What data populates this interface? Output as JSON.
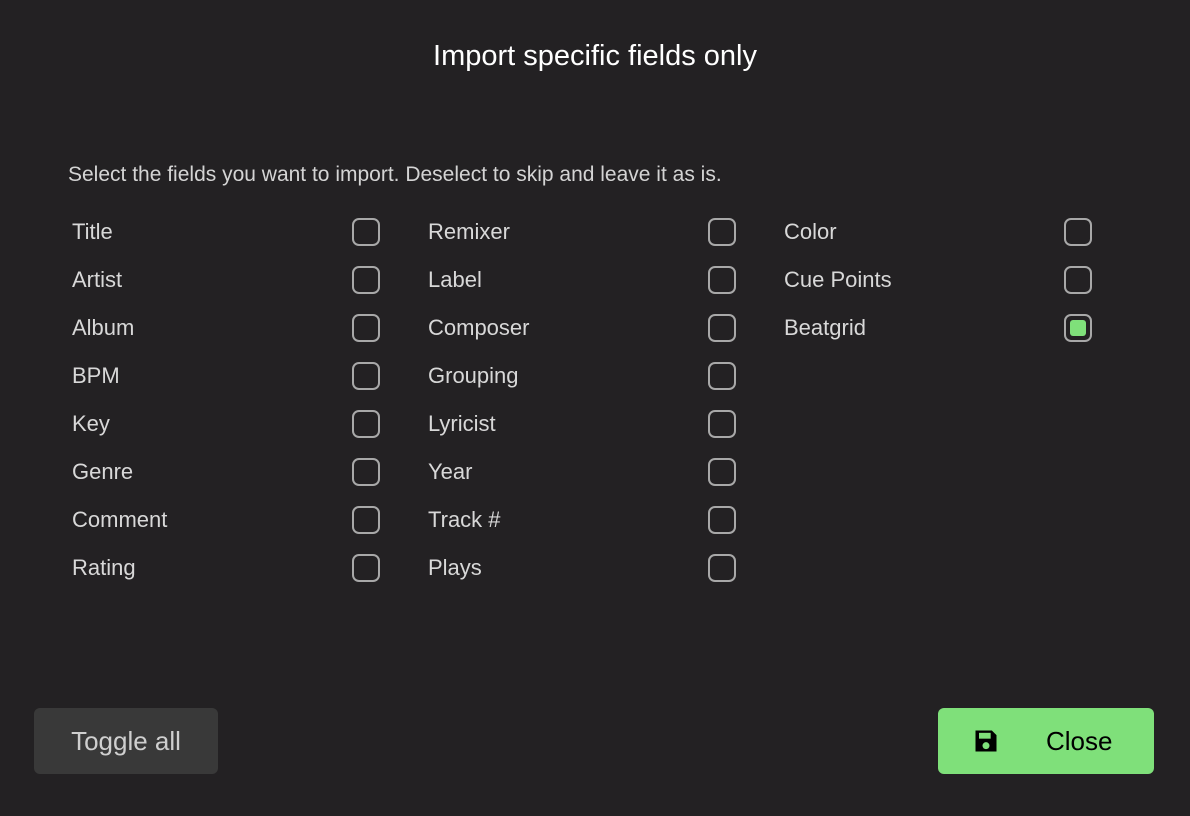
{
  "dialog": {
    "title": "Import specific fields only",
    "description": "Select the fields you want to import. Deselect to skip and leave it as is."
  },
  "fields": {
    "column1": [
      {
        "label": "Title",
        "checked": false
      },
      {
        "label": "Artist",
        "checked": false
      },
      {
        "label": "Album",
        "checked": false
      },
      {
        "label": "BPM",
        "checked": false
      },
      {
        "label": "Key",
        "checked": false
      },
      {
        "label": "Genre",
        "checked": false
      },
      {
        "label": "Comment",
        "checked": false
      },
      {
        "label": "Rating",
        "checked": false
      }
    ],
    "column2": [
      {
        "label": "Remixer",
        "checked": false
      },
      {
        "label": "Label",
        "checked": false
      },
      {
        "label": "Composer",
        "checked": false
      },
      {
        "label": "Grouping",
        "checked": false
      },
      {
        "label": "Lyricist",
        "checked": false
      },
      {
        "label": "Year",
        "checked": false
      },
      {
        "label": "Track #",
        "checked": false
      },
      {
        "label": "Plays",
        "checked": false
      }
    ],
    "column3": [
      {
        "label": "Color",
        "checked": false
      },
      {
        "label": "Cue Points",
        "checked": false
      },
      {
        "label": "Beatgrid",
        "checked": true
      }
    ]
  },
  "buttons": {
    "toggle_all": "Toggle all",
    "close": "Close",
    "close_icon": "floppy-disk-icon"
  },
  "colors": {
    "accent": "#7fe07a",
    "background": "#232123"
  }
}
